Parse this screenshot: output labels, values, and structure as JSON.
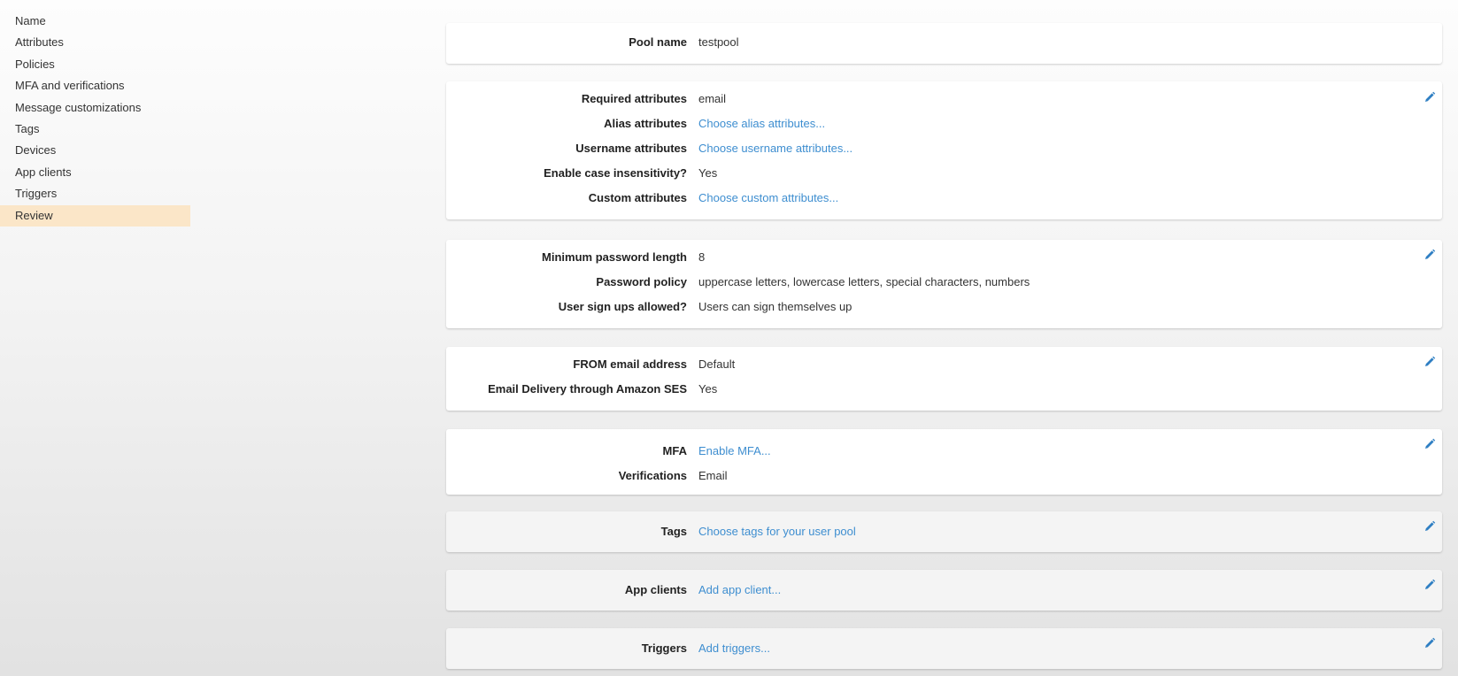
{
  "sidebar": {
    "items": [
      {
        "label": "Name"
      },
      {
        "label": "Attributes"
      },
      {
        "label": "Policies"
      },
      {
        "label": "MFA and verifications"
      },
      {
        "label": "Message customizations"
      },
      {
        "label": "Tags"
      },
      {
        "label": "Devices"
      },
      {
        "label": "App clients"
      },
      {
        "label": "Triggers"
      },
      {
        "label": "Review",
        "active": true
      }
    ]
  },
  "review": {
    "pool": {
      "label": "Pool name",
      "value": "testpool"
    },
    "attributes": [
      {
        "label": "Required attributes",
        "value": "email"
      },
      {
        "label": "Alias attributes",
        "value": "Choose alias attributes..."
      },
      {
        "label": "Username attributes",
        "value": "Choose username attributes..."
      },
      {
        "label": "Enable case insensitivity?",
        "value": "Yes"
      },
      {
        "label": "Custom attributes",
        "value": "Choose custom attributes..."
      }
    ],
    "policies": [
      {
        "label": "Minimum password length",
        "value": "8"
      },
      {
        "label": "Password policy",
        "value": "uppercase letters, lowercase letters, special characters, numbers"
      },
      {
        "label": "User sign ups allowed?",
        "value": "Users can sign themselves up"
      }
    ],
    "messages": [
      {
        "label": "FROM email address",
        "value": "Default"
      },
      {
        "label": "Email Delivery through Amazon SES",
        "value": "Yes"
      }
    ],
    "mfa": [
      {
        "label": "MFA",
        "value": "Enable MFA..."
      },
      {
        "label": "Verifications",
        "value": "Email"
      }
    ],
    "tags": {
      "label": "Tags",
      "value": "Choose tags for your user pool"
    },
    "app_clients": {
      "label": "App clients",
      "value": "Add app client..."
    },
    "triggers": {
      "label": "Triggers",
      "value": "Add triggers..."
    }
  },
  "colors": {
    "link": "#3e8ed0",
    "active_nav": "#fbe6c8",
    "edit_icon": "#2f7fc3"
  },
  "icons": {
    "edit": "pencil-icon"
  }
}
